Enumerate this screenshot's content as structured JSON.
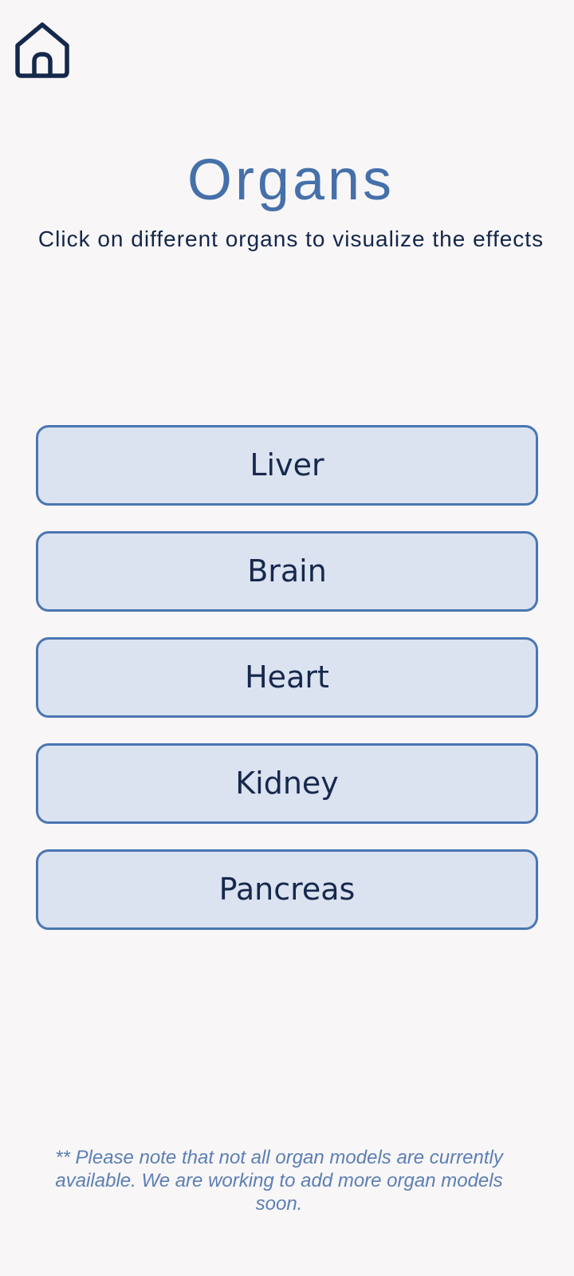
{
  "header": {
    "home_icon": "home-icon"
  },
  "page": {
    "title": "Organs",
    "subtitle": "Click on different organs to visualize the effects"
  },
  "organs": [
    {
      "label": "Liver"
    },
    {
      "label": "Brain"
    },
    {
      "label": "Heart"
    },
    {
      "label": "Kidney"
    },
    {
      "label": "Pancreas"
    }
  ],
  "footer": {
    "note": "** Please note that not all organ models are currently available. We are working to add more organ models soon."
  },
  "colors": {
    "background": "#f8f6f7",
    "title": "#4570aa",
    "text_dark": "#14264a",
    "button_fill": "#dbe2f0",
    "button_border": "#4a76b2",
    "note_text": "#5c7fb3",
    "icon": "#14284b"
  }
}
